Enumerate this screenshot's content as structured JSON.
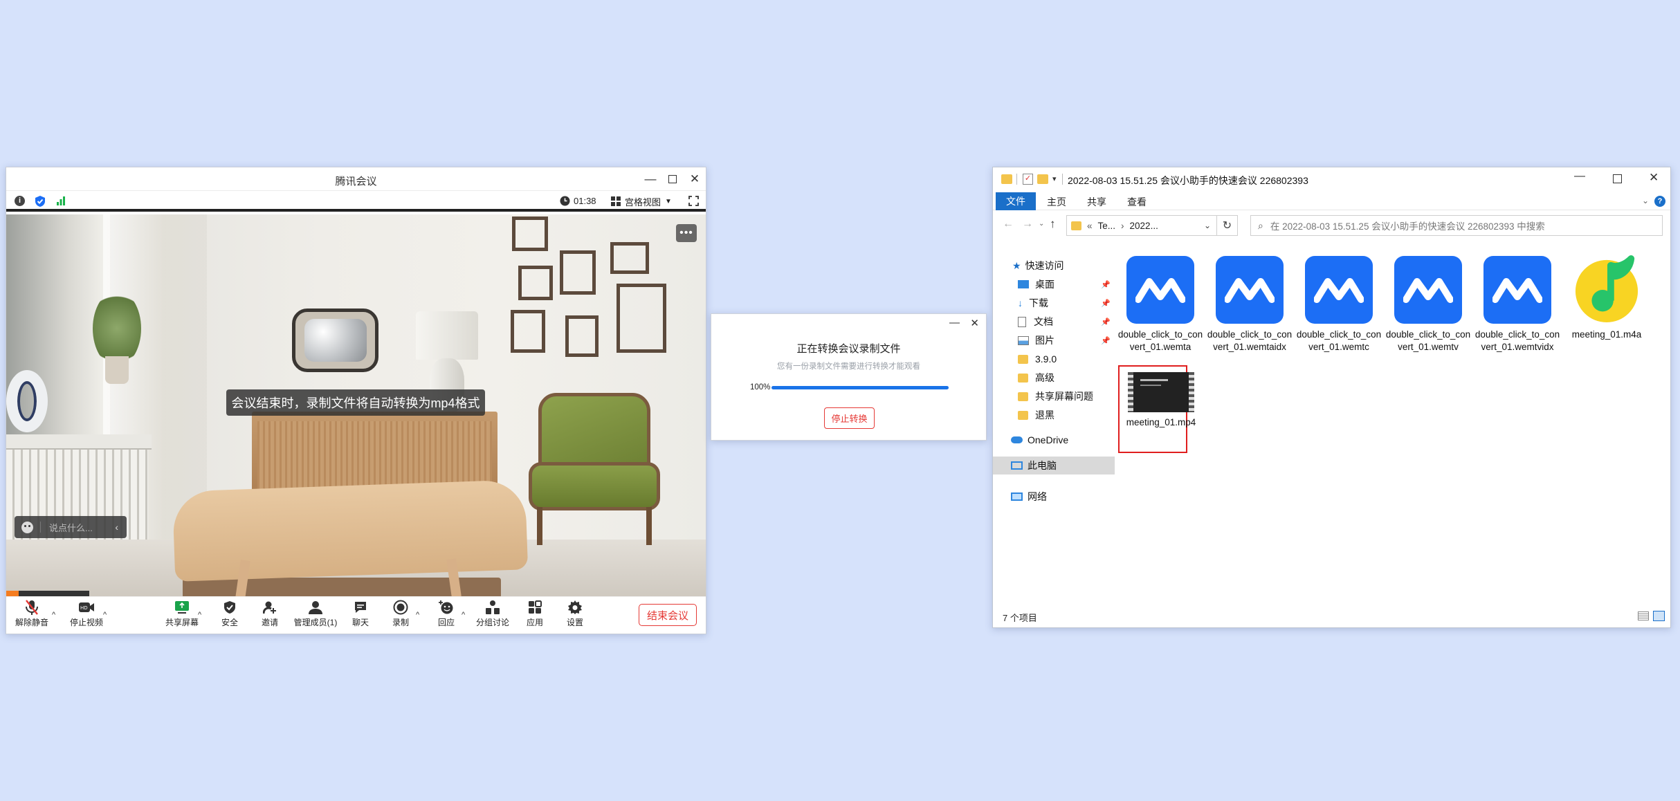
{
  "meeting": {
    "title": "腾讯会议",
    "timer": "01:38",
    "view_mode": "宫格视图",
    "overlay_text": "会议结束时，录制文件将自动转换为mp4格式",
    "chat_placeholder": "说点什么...",
    "end_button": "结束会议",
    "toolbar": [
      {
        "label": "解除静音",
        "icon": "mic-muted-icon"
      },
      {
        "label": "停止视频",
        "icon": "video-icon"
      },
      {
        "label": "共享屏幕",
        "icon": "share-screen-icon"
      },
      {
        "label": "安全",
        "icon": "shield-icon"
      },
      {
        "label": "邀请",
        "icon": "invite-icon"
      },
      {
        "label": "管理成员(1)",
        "icon": "members-icon"
      },
      {
        "label": "聊天",
        "icon": "chat-icon"
      },
      {
        "label": "录制",
        "icon": "record-icon"
      },
      {
        "label": "回应",
        "icon": "reaction-icon"
      },
      {
        "label": "分组讨论",
        "icon": "breakout-icon"
      },
      {
        "label": "应用",
        "icon": "apps-icon"
      },
      {
        "label": "设置",
        "icon": "settings-icon"
      }
    ]
  },
  "dialog": {
    "title": "正在转换会议录制文件",
    "subtitle": "您有一份录制文件需要进行转换才能观看",
    "progress_label": "100%",
    "progress": 1.0,
    "stop_button": "停止转换"
  },
  "explorer": {
    "title": "2022-08-03 15.51.25 会议小助手的快速会议 226802393",
    "ribbon_tabs": [
      "文件",
      "主页",
      "共享",
      "查看"
    ],
    "breadcrumb": [
      "Te...",
      "2022..."
    ],
    "search_placeholder": "在 2022-08-03 15.51.25 会议小助手的快速会议 226802393 中搜索",
    "nav": {
      "quick_access": "快速访问",
      "items": [
        "桌面",
        "下载",
        "文档",
        "图片",
        "3.9.0",
        "高级",
        "共享屏幕问题",
        "退黑"
      ],
      "onedrive": "OneDrive",
      "this_pc": "此电脑",
      "network": "网络"
    },
    "files": [
      {
        "name": "double_click_to_convert_01.wemta"
      },
      {
        "name": "double_click_to_convert_01.wemtaidx"
      },
      {
        "name": "double_click_to_convert_01.wemtc"
      },
      {
        "name": "double_click_to_convert_01.wemtv"
      },
      {
        "name": "double_click_to_convert_01.wemtvidx"
      },
      {
        "name": "meeting_01.m4a"
      },
      {
        "name": "meeting_01.mp4"
      }
    ],
    "status": "7 个项目"
  },
  "colors": {
    "accent": "#1a73e8",
    "danger": "#e53935",
    "tencent_blue": "#1c6ef5",
    "background": "#d6e2fb"
  }
}
